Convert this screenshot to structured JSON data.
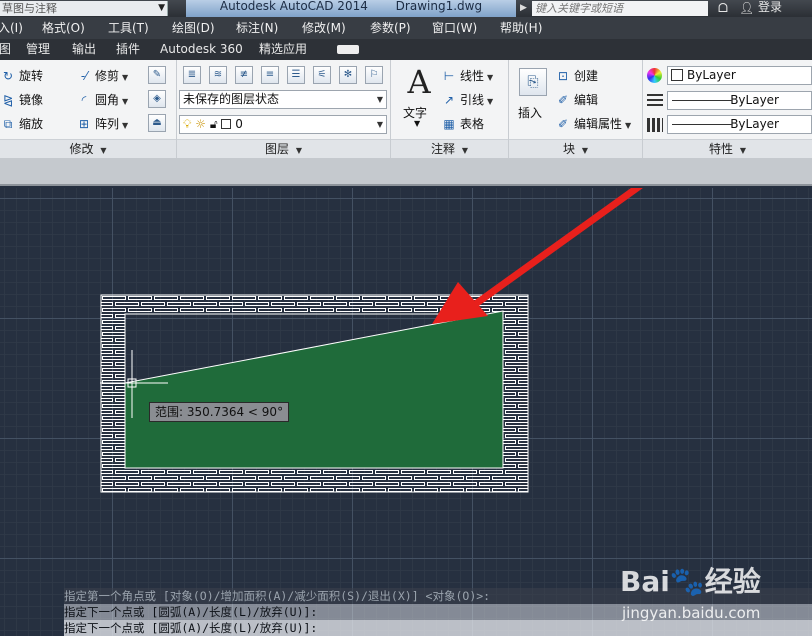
{
  "titlebar": {
    "workspace": "草图与注释",
    "app_title": "Autodesk AutoCAD 2014",
    "file_name": "Drawing1.dwg",
    "search_placeholder": "键入关键字或短语",
    "login": "登录"
  },
  "menu": [
    "入(I)",
    "格式(O)",
    "工具(T)",
    "绘图(D)",
    "标注(N)",
    "修改(M)",
    "参数(P)",
    "窗口(W)",
    "帮助(H)"
  ],
  "ribbon_tabs": [
    "图",
    "管理",
    "输出",
    "插件",
    "Autodesk 360",
    "精选应用"
  ],
  "ribbon": {
    "modify": {
      "title": "修改",
      "tools": [
        "旋转",
        "修剪",
        "镜像",
        "圆角",
        "缩放",
        "阵列"
      ]
    },
    "layers": {
      "title": "图层",
      "layer_state": "未保存的图层状态",
      "current_layer": "0"
    },
    "annotation": {
      "title": "注释",
      "text_label": "文字",
      "tools": [
        "线性",
        "引线",
        "表格"
      ]
    },
    "block": {
      "title": "块",
      "insert_label": "插入",
      "tools": [
        "创建",
        "编辑",
        "编辑属性"
      ]
    },
    "properties": {
      "title": "特性",
      "color": "ByLayer",
      "linetype": "ByLayer",
      "lineweight": "ByLayer"
    }
  },
  "canvas": {
    "tooltip": "范围: 350.7364 < 90°",
    "fill_color": "#1f6b3a",
    "arrow_color": "#e8201c"
  },
  "command_history": [
    "指定第一个角点或 [对象(O)/增加面积(A)/减少面积(S)/退出(X)] <对象(O)>:",
    "指定下一个点或 [圆弧(A)/长度(L)/放弃(U)]:",
    "指定下一个点或 [圆弧(A)/长度(L)/放弃(U)]:"
  ],
  "watermark": {
    "logo": "Bai🐾经验",
    "url": "jingyan.baidu.com"
  }
}
